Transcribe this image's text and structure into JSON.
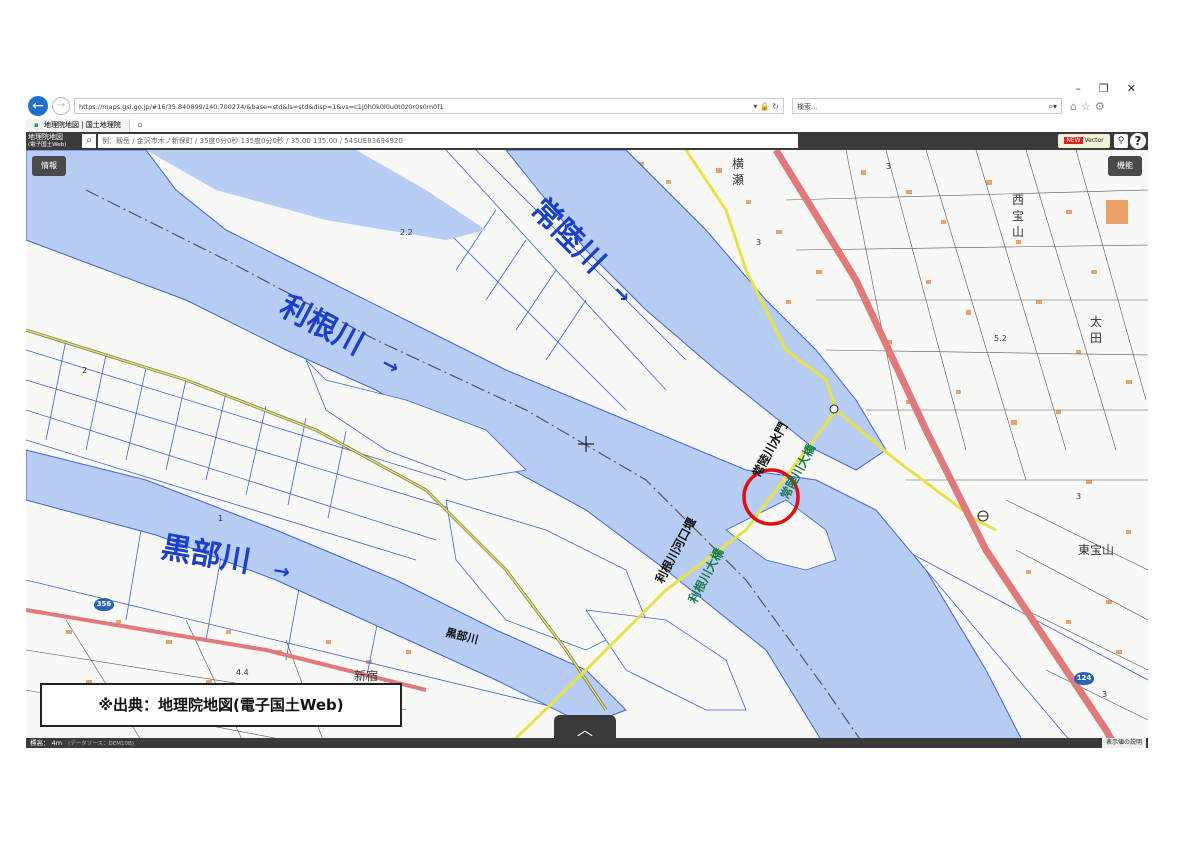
{
  "window_controls": {
    "minimize": "–",
    "restore": "❐",
    "close": "✕"
  },
  "address_bar": {
    "url": "https://maps.gsi.go.jp/#16/35.840899/140.700274/&base=std&ls=std&disp=1&vs=c1j0h0k0l0u0t0z0r0s0m0f1",
    "search_placeholder": "検索..."
  },
  "tabs": [
    {
      "label": "地理院地図 | 国土地理院"
    }
  ],
  "app": {
    "logo_main": "地理院地図",
    "logo_sub": "(電子国土Web)",
    "search_placeholder": "例：剱岳 / 金沢市木ノ新保町 / 35度0分0秒 135度0分0秒 / 35.00 135.00 / 54SUE83694920",
    "vector_new": "NEW",
    "vector_label": "Vector"
  },
  "map": {
    "info_button": "情報",
    "function_button": "機能",
    "river_labels": {
      "tone": "利根川",
      "hitachi": "常陸川",
      "kurobe": "黒部川",
      "arrow": "→"
    },
    "map_labels": {
      "hitachi_sluice": "常陸川水門",
      "tone_weir": "利根川河口堰",
      "tone_bridge": "利根川大橋",
      "hitachi_bridge": "常陸川大橋",
      "kurobe_small": "黒部川",
      "yokose": "横瀬",
      "nishitakara": "西宝山",
      "ota": "太田",
      "higashitakara": "東宝山",
      "shin": "新宿"
    },
    "spot_heights": [
      "2.2",
      "5.2",
      "4.4",
      "2",
      "3",
      "3",
      "3",
      "3",
      "1"
    ],
    "routes": [
      "356",
      "124"
    ],
    "source_note": "※出典：地理院地図(電子国土Web)",
    "collapse_glyph": "︿"
  },
  "status": {
    "elevation": "標高： 4m",
    "data_source": "(データソース：DEM10B)",
    "legend_button": "表示値の説明"
  },
  "colors": {
    "water": "#b7cdf6",
    "land": "#f8f8f6",
    "road_main": "#e07a7a",
    "road_yellow": "#e8e24a",
    "buildings": "#e9a26a",
    "label_blue": "#1a3fcc",
    "marker_red": "#e01010"
  }
}
